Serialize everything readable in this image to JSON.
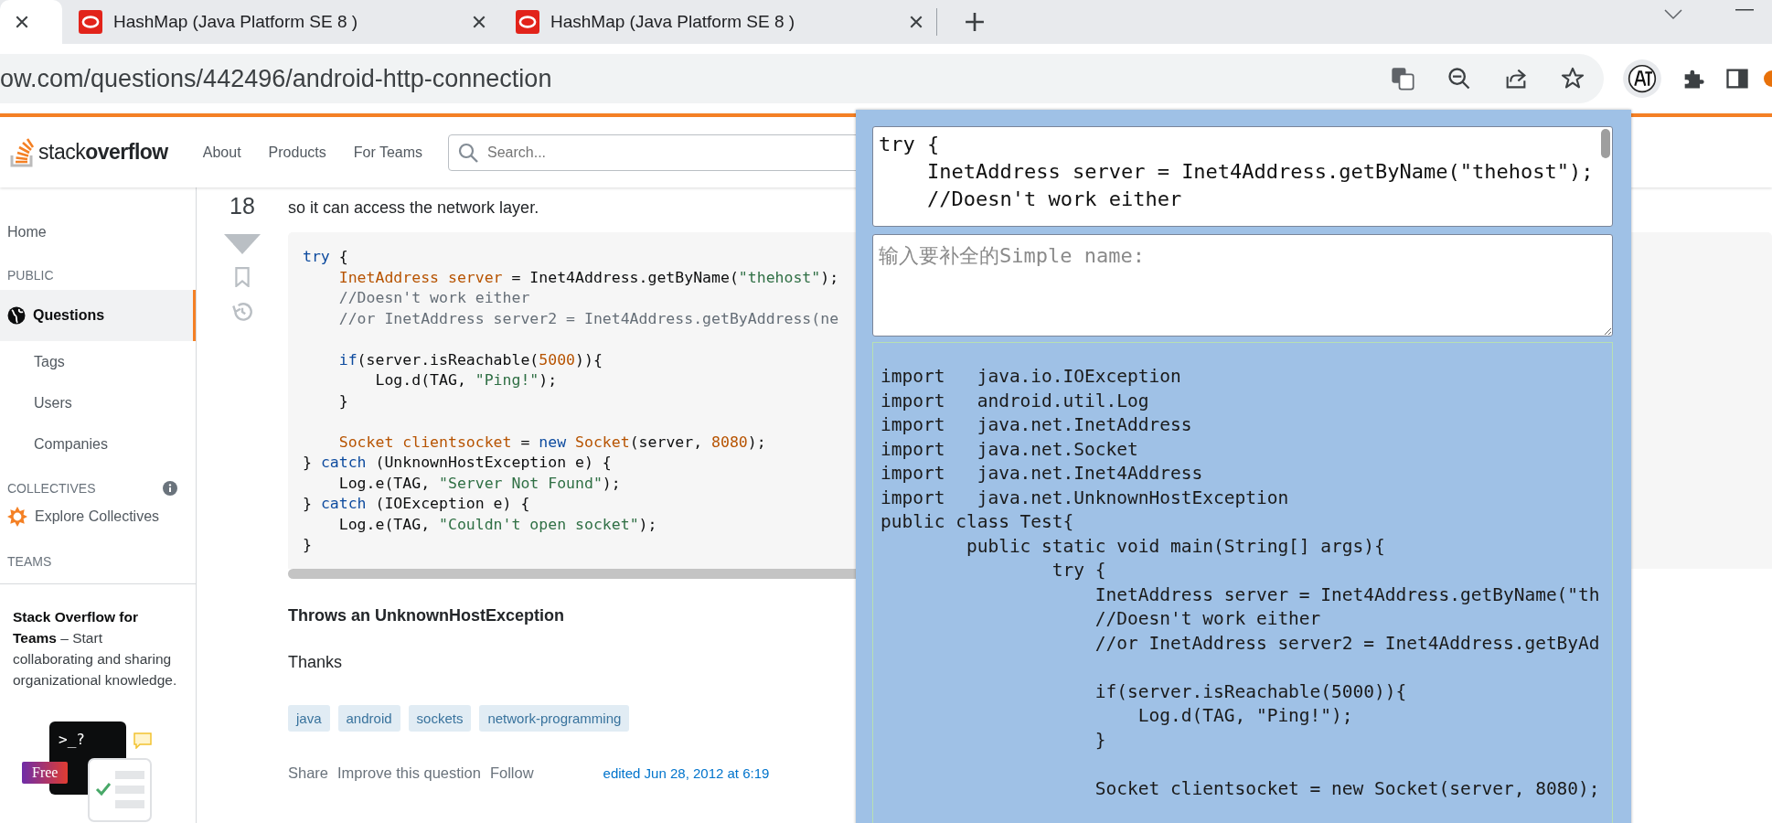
{
  "browser": {
    "tabs": [
      {
        "selected": true
      },
      {
        "title": "HashMap (Java Platform SE 8 )",
        "selected": false
      },
      {
        "title": "HashMap (Java Platform SE 8 )",
        "selected": false
      }
    ],
    "url": "ow.com/questions/442496/android-http-connection"
  },
  "site_header": {
    "logo": "stack**overflow**",
    "nav": [
      "About",
      "Products",
      "For Teams"
    ],
    "search": {
      "placeholder": "Search..."
    }
  },
  "sidebar": {
    "items": [
      {
        "kind": "link",
        "label": "Home",
        "selected": false
      },
      {
        "kind": "heading",
        "label": "PUBLIC"
      },
      {
        "kind": "link",
        "label": "Questions",
        "selected": true
      },
      {
        "kind": "sublink",
        "label": "Tags",
        "selected": false
      },
      {
        "kind": "sublink",
        "label": "Users",
        "selected": false
      },
      {
        "kind": "sublink",
        "label": "Companies",
        "selected": false
      },
      {
        "kind": "heading",
        "label": "COLLECTIVES",
        "info": true
      },
      {
        "kind": "collective",
        "label": "Explore Collectives",
        "selected": false
      },
      {
        "kind": "heading",
        "label": "TEAMS"
      }
    ],
    "teams_promo": {
      "text": "**Stack Overflow for Teams** – Start collaborating and sharing organizational knowledge.",
      "terminal_label": ">_?",
      "badge": "Free"
    }
  },
  "question": {
    "votes": "18",
    "text": "so it can access the network layer.",
    "code": [
      {
        "tokens": [
          {
            "kind": "keyword",
            "text": "try"
          },
          {
            "kind": "plain",
            "text": " {"
          }
        ]
      },
      {
        "tokens": [
          {
            "kind": "type",
            "text": "    InetAddress server"
          },
          {
            "kind": "plain",
            "text": " = Inet4Address.getByName("
          },
          {
            "kind": "string",
            "text": "\"thehost\""
          },
          {
            "kind": "plain",
            "text": ");"
          }
        ]
      },
      {
        "tokens": [
          {
            "kind": "comment",
            "text": "    //Doesn't work either"
          }
        ]
      },
      {
        "tokens": [
          {
            "kind": "comment",
            "text": "    //or InetAddress server2 = Inet4Address.getByAddress(ne"
          }
        ]
      },
      {
        "gap_before": true,
        "tokens": [
          {
            "kind": "keyword",
            "text": "    if"
          },
          {
            "kind": "plain",
            "text": "(server.isReachable("
          },
          {
            "kind": "number",
            "text": "5000"
          },
          {
            "kind": "plain",
            "text": ")){"
          }
        ]
      },
      {
        "tokens": [
          {
            "kind": "plain",
            "text": "        Log.d(TAG, "
          },
          {
            "kind": "string",
            "text": "\"Ping!\""
          },
          {
            "kind": "plain",
            "text": ");"
          }
        ]
      },
      {
        "tokens": [
          {
            "kind": "plain",
            "text": "    }"
          }
        ]
      },
      {
        "gap_before": true,
        "tokens": [
          {
            "kind": "type",
            "text": "    Socket clientsocket"
          },
          {
            "kind": "plain",
            "text": " = "
          },
          {
            "kind": "keyword",
            "text": "new"
          },
          {
            "kind": "type",
            "text": " Socket"
          },
          {
            "kind": "plain",
            "text": "(server, "
          },
          {
            "kind": "number",
            "text": "8080"
          },
          {
            "kind": "plain",
            "text": ");"
          }
        ]
      },
      {
        "tokens": [
          {
            "kind": "plain",
            "text": "} "
          },
          {
            "kind": "keyword",
            "text": "catch"
          },
          {
            "kind": "plain",
            "text": " (UnknownHostException e) {"
          }
        ]
      },
      {
        "tokens": [
          {
            "kind": "plain",
            "text": "    Log.e(TAG, "
          },
          {
            "kind": "string",
            "text": "\"Server Not Found\""
          },
          {
            "kind": "plain",
            "text": ");"
          }
        ]
      },
      {
        "tokens": [
          {
            "kind": "plain",
            "text": "} "
          },
          {
            "kind": "keyword",
            "text": "catch"
          },
          {
            "kind": "plain",
            "text": " (IOException e) {"
          }
        ]
      },
      {
        "tokens": [
          {
            "kind": "plain",
            "text": "    Log.e(TAG, "
          },
          {
            "kind": "string",
            "text": "\"Couldn't open socket\""
          },
          {
            "kind": "plain",
            "text": ");"
          }
        ]
      },
      {
        "tokens": [
          {
            "kind": "plain",
            "text": "}"
          }
        ]
      }
    ],
    "heading": "Throws an UnknownHostException",
    "thanks": "Thanks",
    "tags": [
      "java",
      "android",
      "sockets",
      "network-programming"
    ],
    "actions": [
      "Share",
      "Improve this question",
      "Follow"
    ],
    "edited": "edited Jun 28, 2012 at 6:19"
  },
  "popup": {
    "source_lines": [
      "try {",
      "    InetAddress server = Inet4Address.getByName(\"thehost\");",
      "    //Doesn't work either"
    ],
    "name_field": {
      "placeholder": "输入要补全的Simple name:"
    },
    "output": [
      {
        "text": "import   java.io.IOException"
      },
      {
        "text": "import   android.util.Log"
      },
      {
        "text": "import   java.net.InetAddress"
      },
      {
        "text": "import   java.net.Socket"
      },
      {
        "text": "import   java.net.Inet4Address"
      },
      {
        "text": "import   java.net.UnknownHostException"
      },
      {
        "text": "public class Test{"
      },
      {
        "text": "        public static void main(String[] args){"
      },
      {
        "text": "                try {"
      },
      {
        "text": "                    InetAddress server = Inet4Address.getByName(\"th"
      },
      {
        "text": "                    //Doesn't work either"
      },
      {
        "text": "                    //or InetAddress server2 = Inet4Address.getByAd"
      },
      {
        "text": "                    if(server.isReachable(5000)){",
        "gap_before": true
      },
      {
        "text": "                        Log.d(TAG, \"Ping!\");"
      },
      {
        "text": "                    }"
      },
      {
        "text": "                    Socket clientsocket = new Socket(server, 8080);",
        "gap_before": true
      }
    ]
  }
}
